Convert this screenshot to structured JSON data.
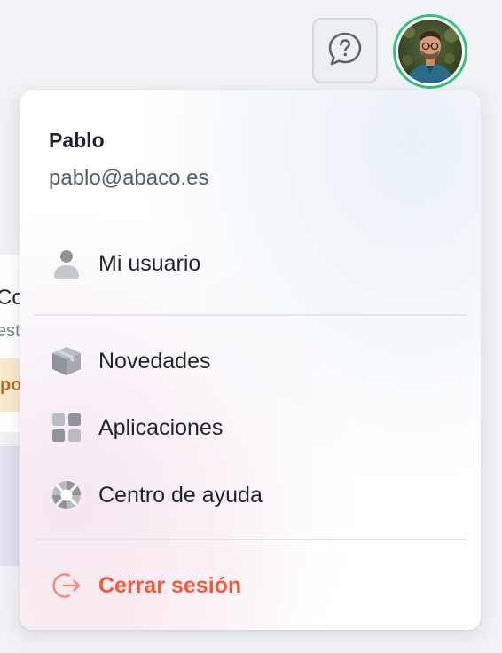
{
  "background": {
    "card_title": "Co",
    "card_subtitle": "est",
    "badge_text": "po"
  },
  "header": {
    "help_icon": "help-chat-icon",
    "avatar_icon": "user-avatar"
  },
  "user": {
    "name": "Pablo",
    "email": "pablo@abaco.es"
  },
  "menu": {
    "profile": {
      "label": "Mi usuario",
      "icon": "user-icon"
    },
    "news": {
      "label": "Novedades",
      "icon": "package-icon"
    },
    "apps": {
      "label": "Aplicaciones",
      "icon": "grid-icon"
    },
    "help": {
      "label": "Centro de ayuda",
      "icon": "lifebuoy-icon"
    },
    "logout": {
      "label": "Cerrar sesión",
      "icon": "logout-icon"
    }
  },
  "colors": {
    "accent_green": "#35c07e",
    "logout_red": "#ee5a3e",
    "icon_gray": "#8f939b"
  }
}
